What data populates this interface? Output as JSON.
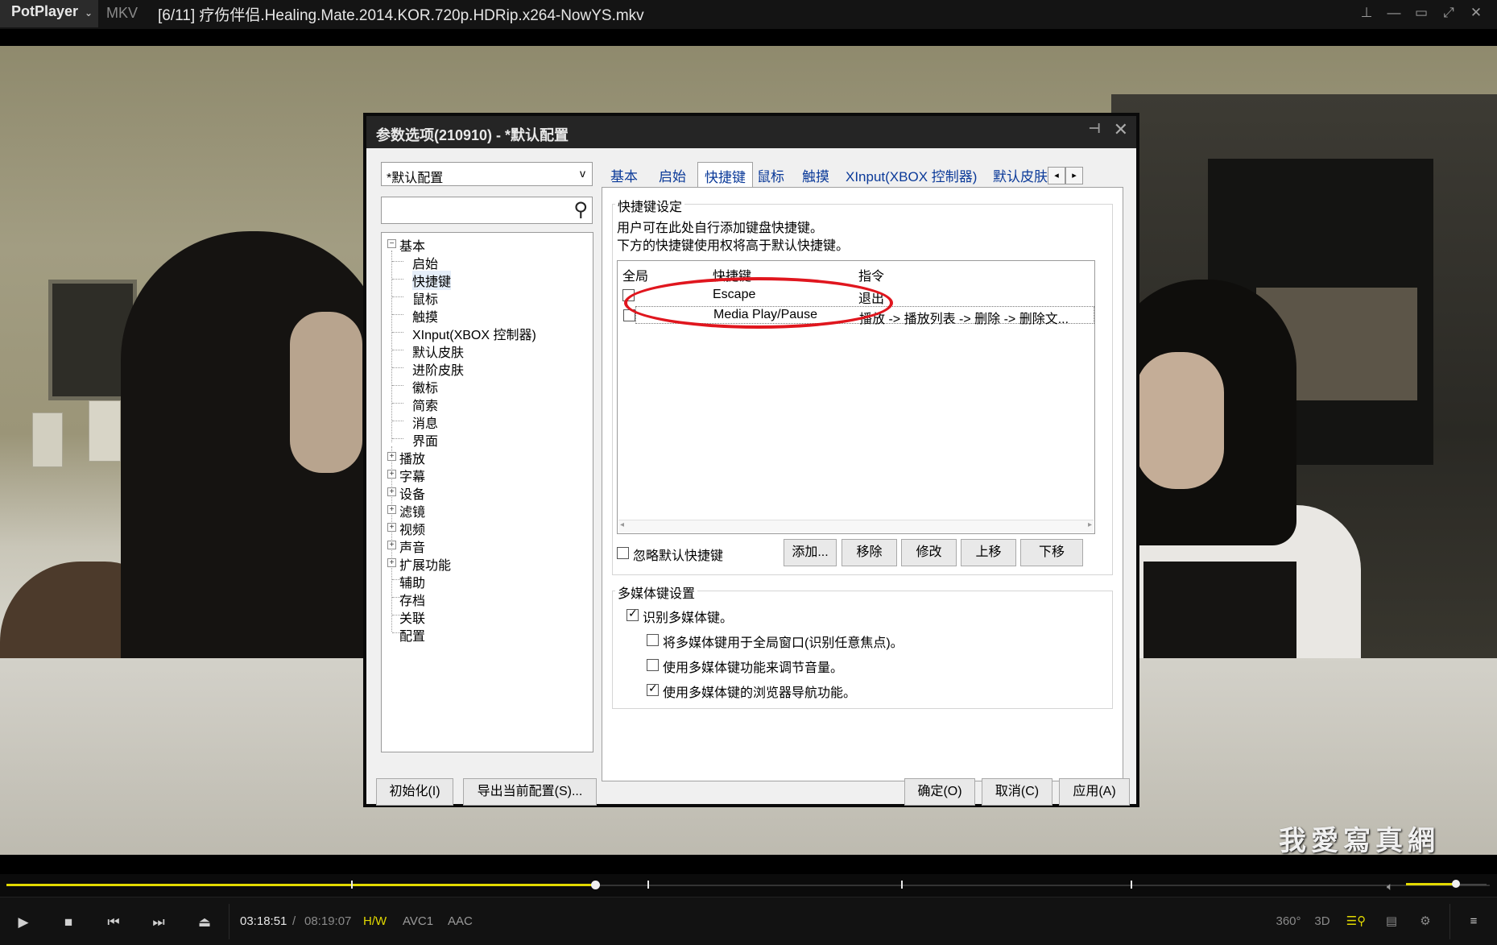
{
  "titlebar": {
    "app_name": "PotPlayer",
    "format": "MKV",
    "title": "[6/11] 疗伤伴侣.Healing.Mate.2014.KOR.720p.HDRip.x264-NowYS.mkv"
  },
  "watermark": "我愛寫真網",
  "dialog": {
    "title": "参数选项(210910) - *默认配置",
    "profile": "*默认配置",
    "profile_arrow": "v",
    "search_placeholder": "",
    "tree": [
      {
        "label": "基本",
        "expander": "⊟"
      },
      {
        "label": "启始"
      },
      {
        "label": "快捷键"
      },
      {
        "label": "鼠标"
      },
      {
        "label": "触摸"
      },
      {
        "label": "XInput(XBOX 控制器)"
      },
      {
        "label": "默认皮肤"
      },
      {
        "label": "进阶皮肤"
      },
      {
        "label": "徽标"
      },
      {
        "label": "简索"
      },
      {
        "label": "消息"
      },
      {
        "label": "界面"
      },
      {
        "label": "播放",
        "expander": "⊞"
      },
      {
        "label": "字幕",
        "expander": "⊞"
      },
      {
        "label": "设备",
        "expander": "⊞"
      },
      {
        "label": "滤镜",
        "expander": "⊞"
      },
      {
        "label": "视频",
        "expander": "⊞"
      },
      {
        "label": "声音",
        "expander": "⊞"
      },
      {
        "label": "扩展功能",
        "expander": "⊞"
      },
      {
        "label": "辅助"
      },
      {
        "label": "存档"
      },
      {
        "label": "关联"
      },
      {
        "label": "配置"
      }
    ],
    "tabs": [
      "基本",
      "启始",
      "快捷键",
      "鼠标",
      "触摸",
      "XInput(XBOX 控制器)",
      "默认皮肤"
    ],
    "hotkey_group": {
      "title": "快捷键设定",
      "desc1": "用户可在此处自行添加键盘快捷键。",
      "desc2": "下方的快捷键使用权将高于默认快捷键。",
      "columns": [
        "全局",
        "快捷键",
        "指令"
      ],
      "rows": [
        {
          "global": false,
          "key": "Escape",
          "command": "退出"
        },
        {
          "global": false,
          "key": "Media Play/Pause",
          "command": "播放 -> 播放列表 -> 删除 -> 删除文..."
        }
      ],
      "ignore_default": "忽略默认快捷键",
      "buttons": {
        "add": "添加...",
        "remove": "移除",
        "edit": "修改",
        "up": "上移",
        "down": "下移"
      }
    },
    "media_group": {
      "title": "多媒体键设置",
      "opt1": "识别多媒体键。",
      "opt2": "将多媒体键用于全局窗口(识别任意焦点)。",
      "opt3": "使用多媒体键功能来调节音量。",
      "opt4": "使用多媒体键的浏览器导航功能。",
      "opt1_checked": true,
      "opt2_checked": false,
      "opt3_checked": false,
      "opt4_checked": true
    },
    "footer": {
      "reset": "初始化(I)",
      "export": "导出当前配置(S)...",
      "ok": "确定(O)",
      "cancel": "取消(C)",
      "apply": "应用(A)"
    }
  },
  "player": {
    "time_current": "03:18:51",
    "time_separator": "/",
    "time_total": "08:19:07",
    "hw_tag": "H/W",
    "video_codec": "AVC1",
    "audio_codec": "AAC",
    "btn_360": "360°",
    "btn_3d": "3D",
    "progress_fraction": 0.397,
    "volume_fraction": 0.62,
    "accent_color": "#e2d900"
  },
  "icons": [
    "pin-icon",
    "minimize-icon",
    "maximize-icon",
    "fullscreen-icon",
    "close-icon",
    "play-icon",
    "stop-icon",
    "prev-icon",
    "next-icon",
    "eject-icon",
    "volume-icon",
    "search-icon",
    "playlist-icon",
    "settings-icon",
    "menu-icon"
  ]
}
